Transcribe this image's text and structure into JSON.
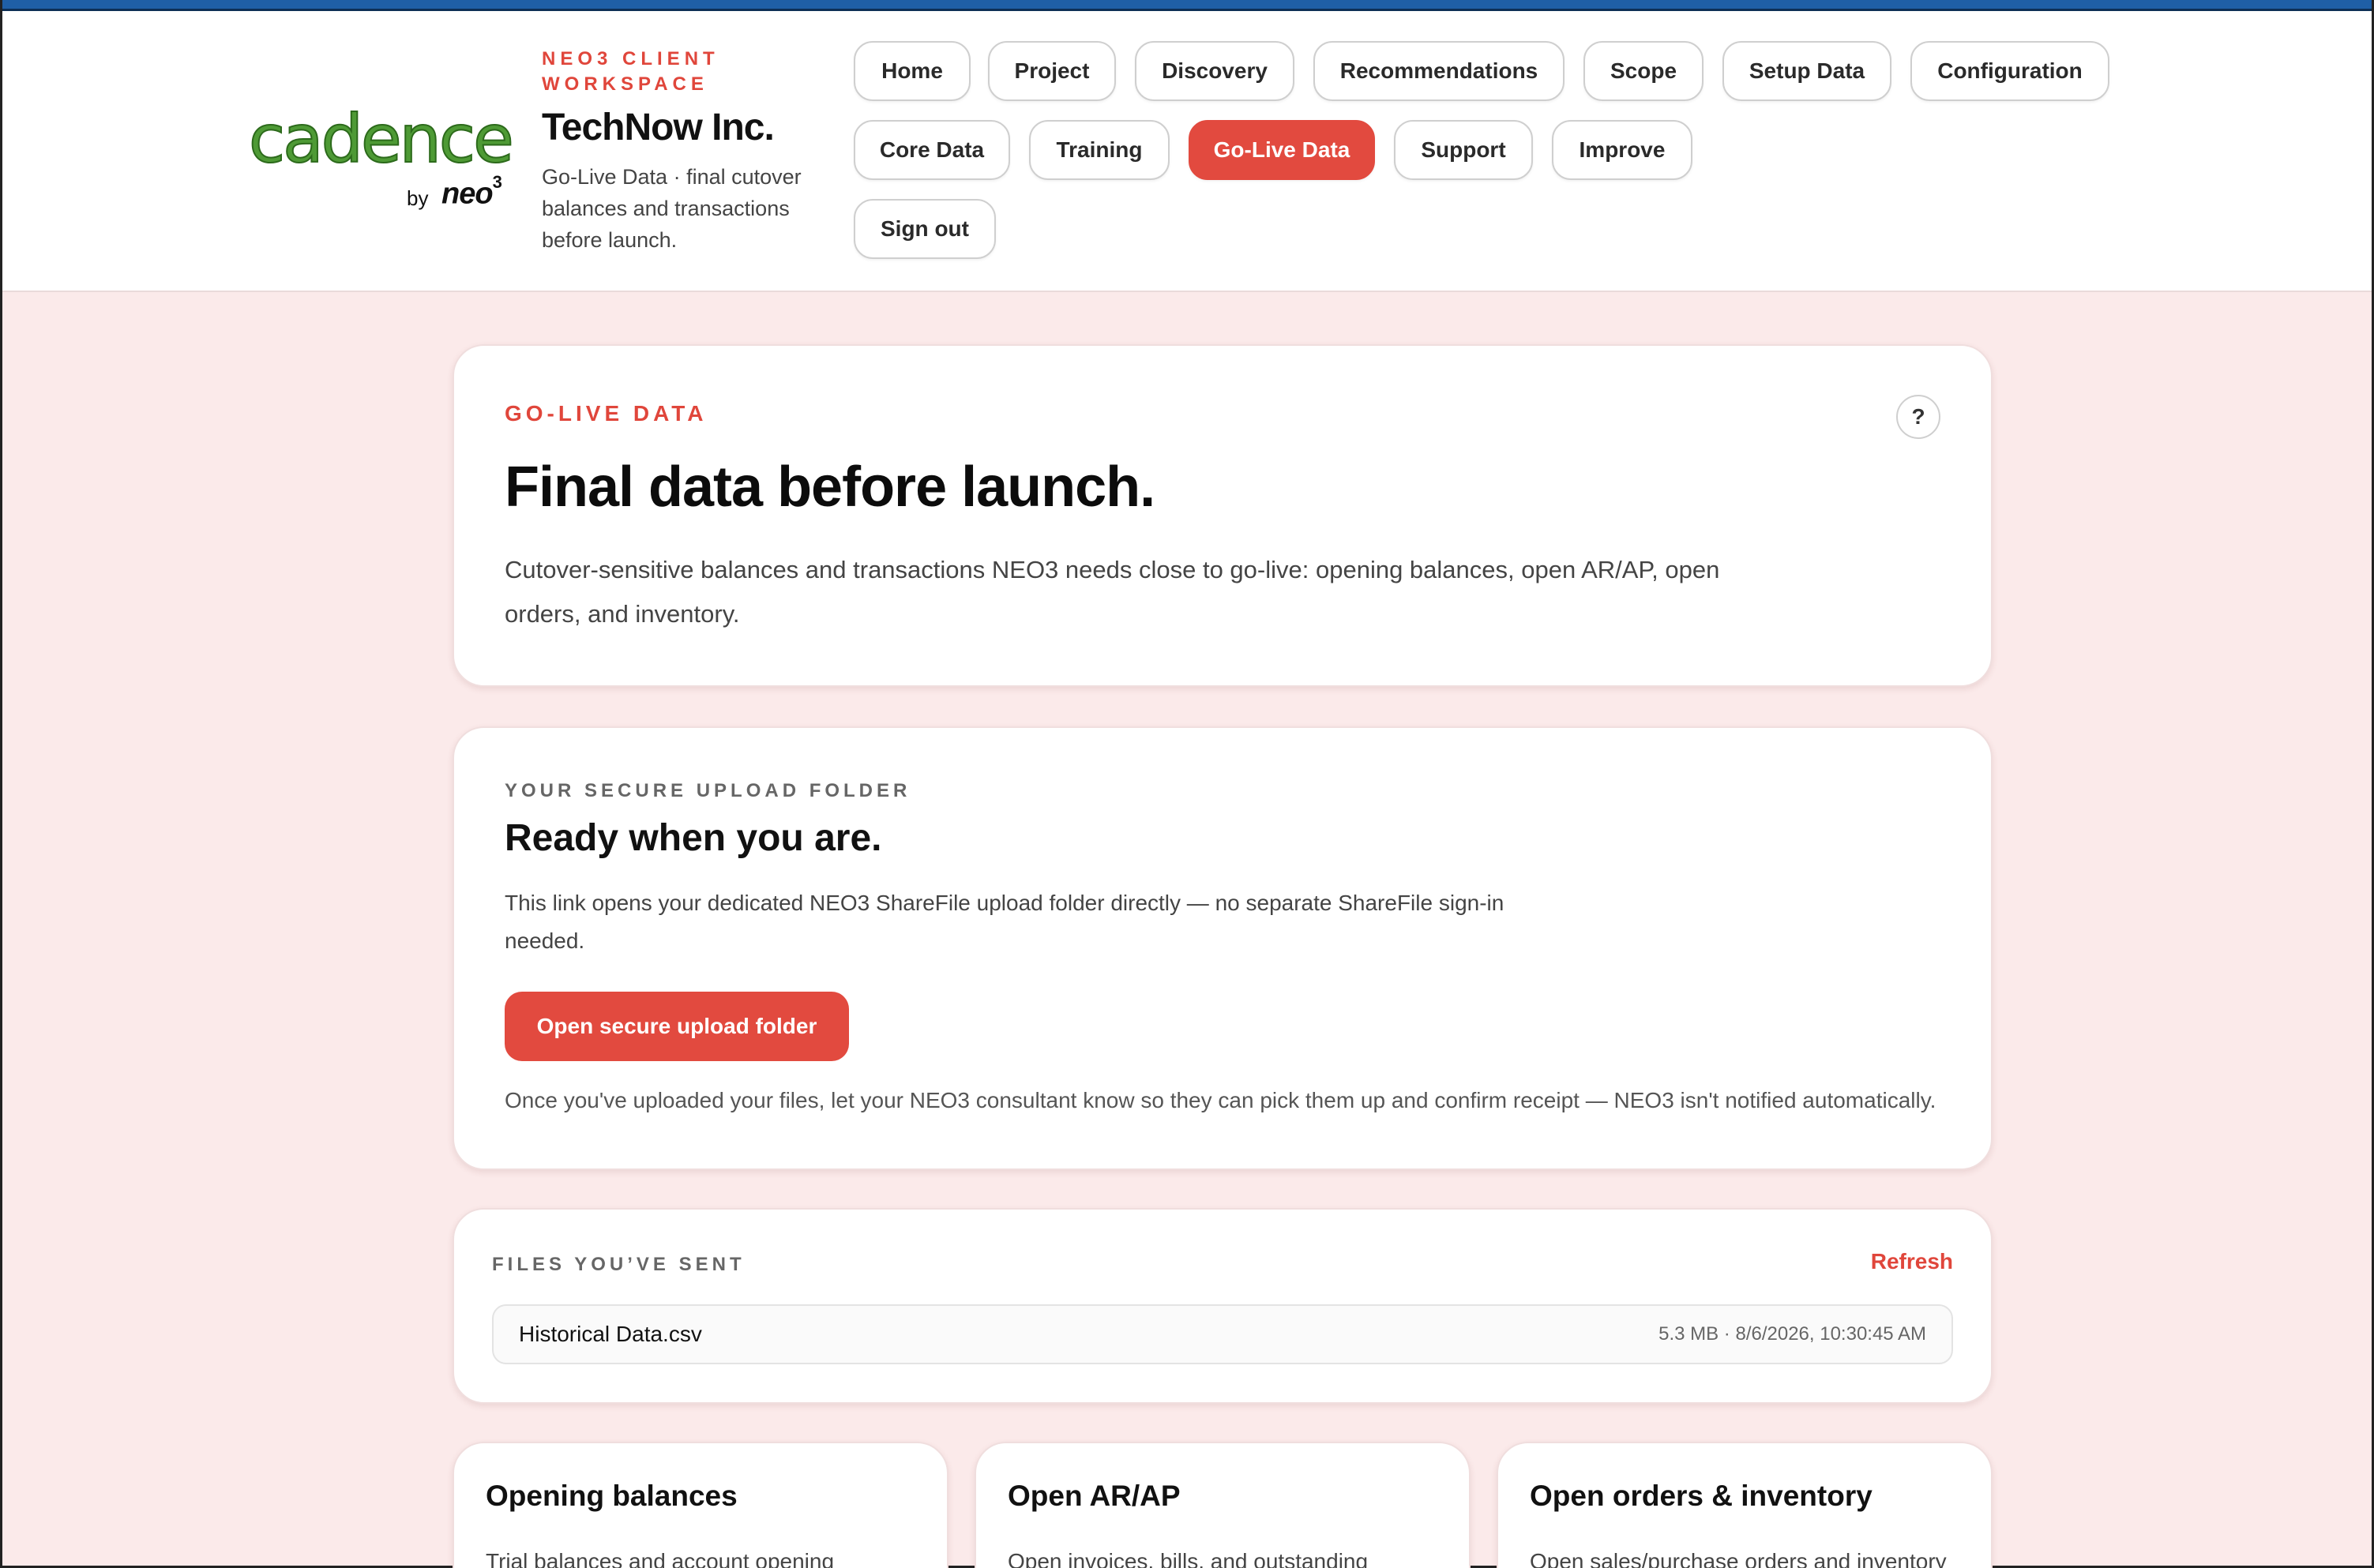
{
  "brand": {
    "logo_word": "cadence",
    "logo_by": "by",
    "logo_neo": "neo",
    "logo_neo_sup": "3"
  },
  "header": {
    "eyebrow": "NEO3 CLIENT WORKSPACE",
    "client_name": "TechNow Inc.",
    "description": "Go-Live Data · final cutover balances and transactions before launch."
  },
  "nav": {
    "items": [
      {
        "label": "Home"
      },
      {
        "label": "Project"
      },
      {
        "label": "Discovery"
      },
      {
        "label": "Recommendations"
      },
      {
        "label": "Scope"
      },
      {
        "label": "Setup Data"
      },
      {
        "label": "Configuration"
      },
      {
        "label": "Core Data"
      },
      {
        "label": "Training"
      },
      {
        "label": "Go-Live Data"
      },
      {
        "label": "Support"
      },
      {
        "label": "Improve"
      },
      {
        "label": "Sign out"
      }
    ],
    "active": "Go-Live Data"
  },
  "hero": {
    "eyebrow": "GO-LIVE DATA",
    "help_icon": "?",
    "title": "Final data before launch.",
    "description": "Cutover-sensitive balances and transactions NEO3 needs close to go-live: opening balances, open AR/AP, open orders, and inventory."
  },
  "upload": {
    "eyebrow": "YOUR SECURE UPLOAD FOLDER",
    "title": "Ready when you are.",
    "description": "This link opens your dedicated NEO3 ShareFile upload folder directly — no separate ShareFile sign-in needed.",
    "button_label": "Open secure upload folder",
    "note": "Once you've uploaded your files, let your NEO3 consultant know so they can pick them up and confirm receipt — NEO3 isn't notified automatically."
  },
  "files": {
    "eyebrow": "FILES YOU’VE SENT",
    "refresh_label": "Refresh",
    "items": [
      {
        "name": "Historical Data.csv",
        "meta": "5.3 MB · 8/6/2026, 10:30:45 AM"
      }
    ]
  },
  "tiles": [
    {
      "title": "Opening balances",
      "description": "Trial balances and account opening"
    },
    {
      "title": "Open AR/AP",
      "description": "Open invoices, bills, and outstanding"
    },
    {
      "title": "Open orders & inventory",
      "description": "Open sales/purchase orders and inventory"
    }
  ],
  "colors": {
    "accent": "#e24a3f",
    "page_background": "#fbeaea",
    "top_bar": "#1f5fa6",
    "logo_green": "#4e9a35"
  }
}
